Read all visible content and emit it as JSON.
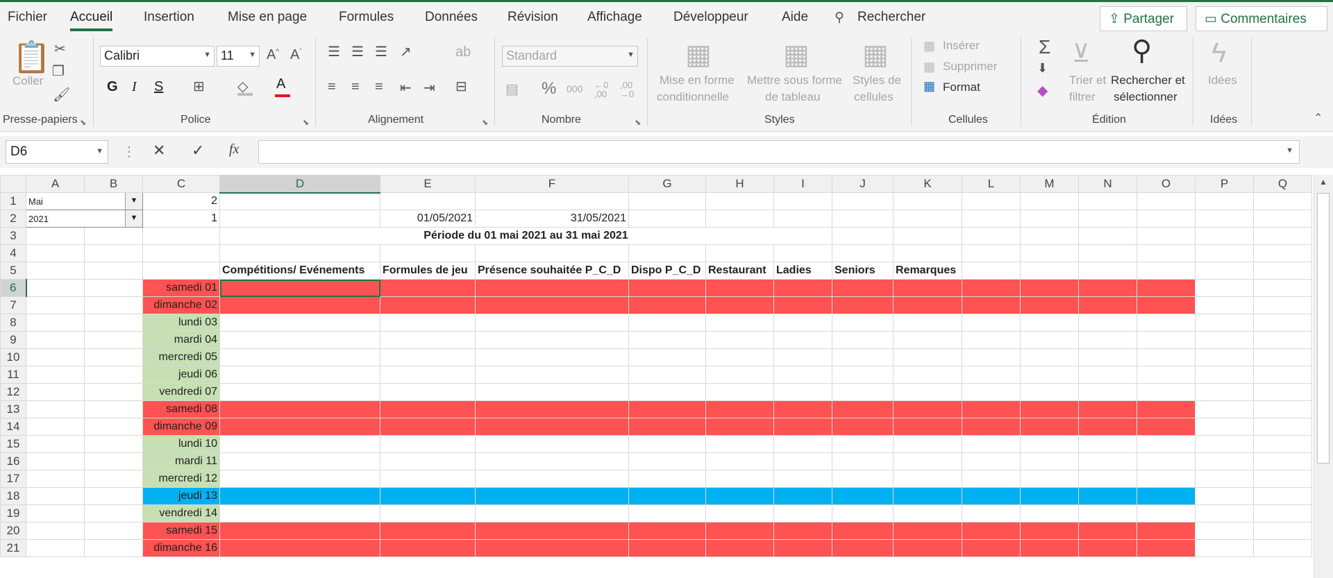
{
  "menu": {
    "tabs": [
      "Fichier",
      "Accueil",
      "Insertion",
      "Mise en page",
      "Formules",
      "Données",
      "Révision",
      "Affichage",
      "Développeur",
      "Aide"
    ],
    "active_tab": "Accueil",
    "search_label": "Rechercher",
    "share_label": "Partager",
    "comments_label": "Commentaires"
  },
  "ribbon": {
    "clipboard": {
      "paste_label": "Coller",
      "group_label": "Presse-papiers"
    },
    "font": {
      "name": "Calibri",
      "size": "11",
      "bold": "G",
      "italic": "I",
      "underline": "S",
      "group_label": "Police"
    },
    "alignment": {
      "group_label": "Alignement"
    },
    "number": {
      "format": "Standard",
      "group_label": "Nombre",
      "percent": "%",
      "thousands": "000",
      "inc_decimal": "←0 ,00",
      "dec_decimal": ",00 →0"
    },
    "styles": {
      "conditional_1": "Mise en forme",
      "conditional_2": "conditionnelle",
      "table_1": "Mettre sous forme",
      "table_2": "de tableau",
      "cell_1": "Styles de",
      "cell_2": "cellules",
      "group_label": "Styles"
    },
    "cells": {
      "insert": "Insérer",
      "delete": "Supprimer",
      "format": "Format",
      "group_label": "Cellules"
    },
    "editing": {
      "sort_1": "Trier et",
      "sort_2": "filtrer",
      "find_1": "Rechercher et",
      "find_2": "sélectionner",
      "group_label": "Édition"
    },
    "ideas": {
      "label": "Idées",
      "group_label": "Idées"
    }
  },
  "formula_bar": {
    "name_box": "D6",
    "fx": "fx",
    "value": ""
  },
  "grid": {
    "columns": [
      "A",
      "B",
      "C",
      "D",
      "E",
      "F",
      "G",
      "H",
      "I",
      "J",
      "K",
      "L",
      "M",
      "N",
      "O",
      "P",
      "Q"
    ],
    "selected_column": "D",
    "selected_row": 6,
    "month_dropdown": "Mai",
    "year_dropdown": "2021",
    "c1": "2",
    "c2": "1",
    "start_date": "01/05/2021",
    "end_date": "31/05/2021",
    "period": "Période du 01 mai 2021 au 31 mai 2021",
    "headers": [
      "Compétitions/ Evénements",
      "Formules de jeu",
      "Présence souhaitée P_C_D",
      "Dispo P_C_D",
      "Restaurant",
      "Ladies",
      "Seniors",
      "Remarques"
    ],
    "days": [
      {
        "row": 6,
        "label": "samedi 01",
        "type": "red"
      },
      {
        "row": 7,
        "label": "dimanche 02",
        "type": "red"
      },
      {
        "row": 8,
        "label": "lundi 03",
        "type": "green"
      },
      {
        "row": 9,
        "label": "mardi 04",
        "type": "green"
      },
      {
        "row": 10,
        "label": "mercredi 05",
        "type": "green"
      },
      {
        "row": 11,
        "label": "jeudi 06",
        "type": "green"
      },
      {
        "row": 12,
        "label": "vendredi 07",
        "type": "green"
      },
      {
        "row": 13,
        "label": "samedi 08",
        "type": "red"
      },
      {
        "row": 14,
        "label": "dimanche 09",
        "type": "red"
      },
      {
        "row": 15,
        "label": "lundi 10",
        "type": "green"
      },
      {
        "row": 16,
        "label": "mardi 11",
        "type": "green"
      },
      {
        "row": 17,
        "label": "mercredi 12",
        "type": "green"
      },
      {
        "row": 18,
        "label": "jeudi 13",
        "type": "blue"
      },
      {
        "row": 19,
        "label": "vendredi 14",
        "type": "green"
      },
      {
        "row": 20,
        "label": "samedi 15",
        "type": "red"
      },
      {
        "row": 21,
        "label": "dimanche 16",
        "type": "red"
      }
    ],
    "colors": {
      "weekend": "#ff5252",
      "weekday": "#c6e0b4",
      "holiday": "#00b0f0",
      "accent": "#217346"
    }
  }
}
